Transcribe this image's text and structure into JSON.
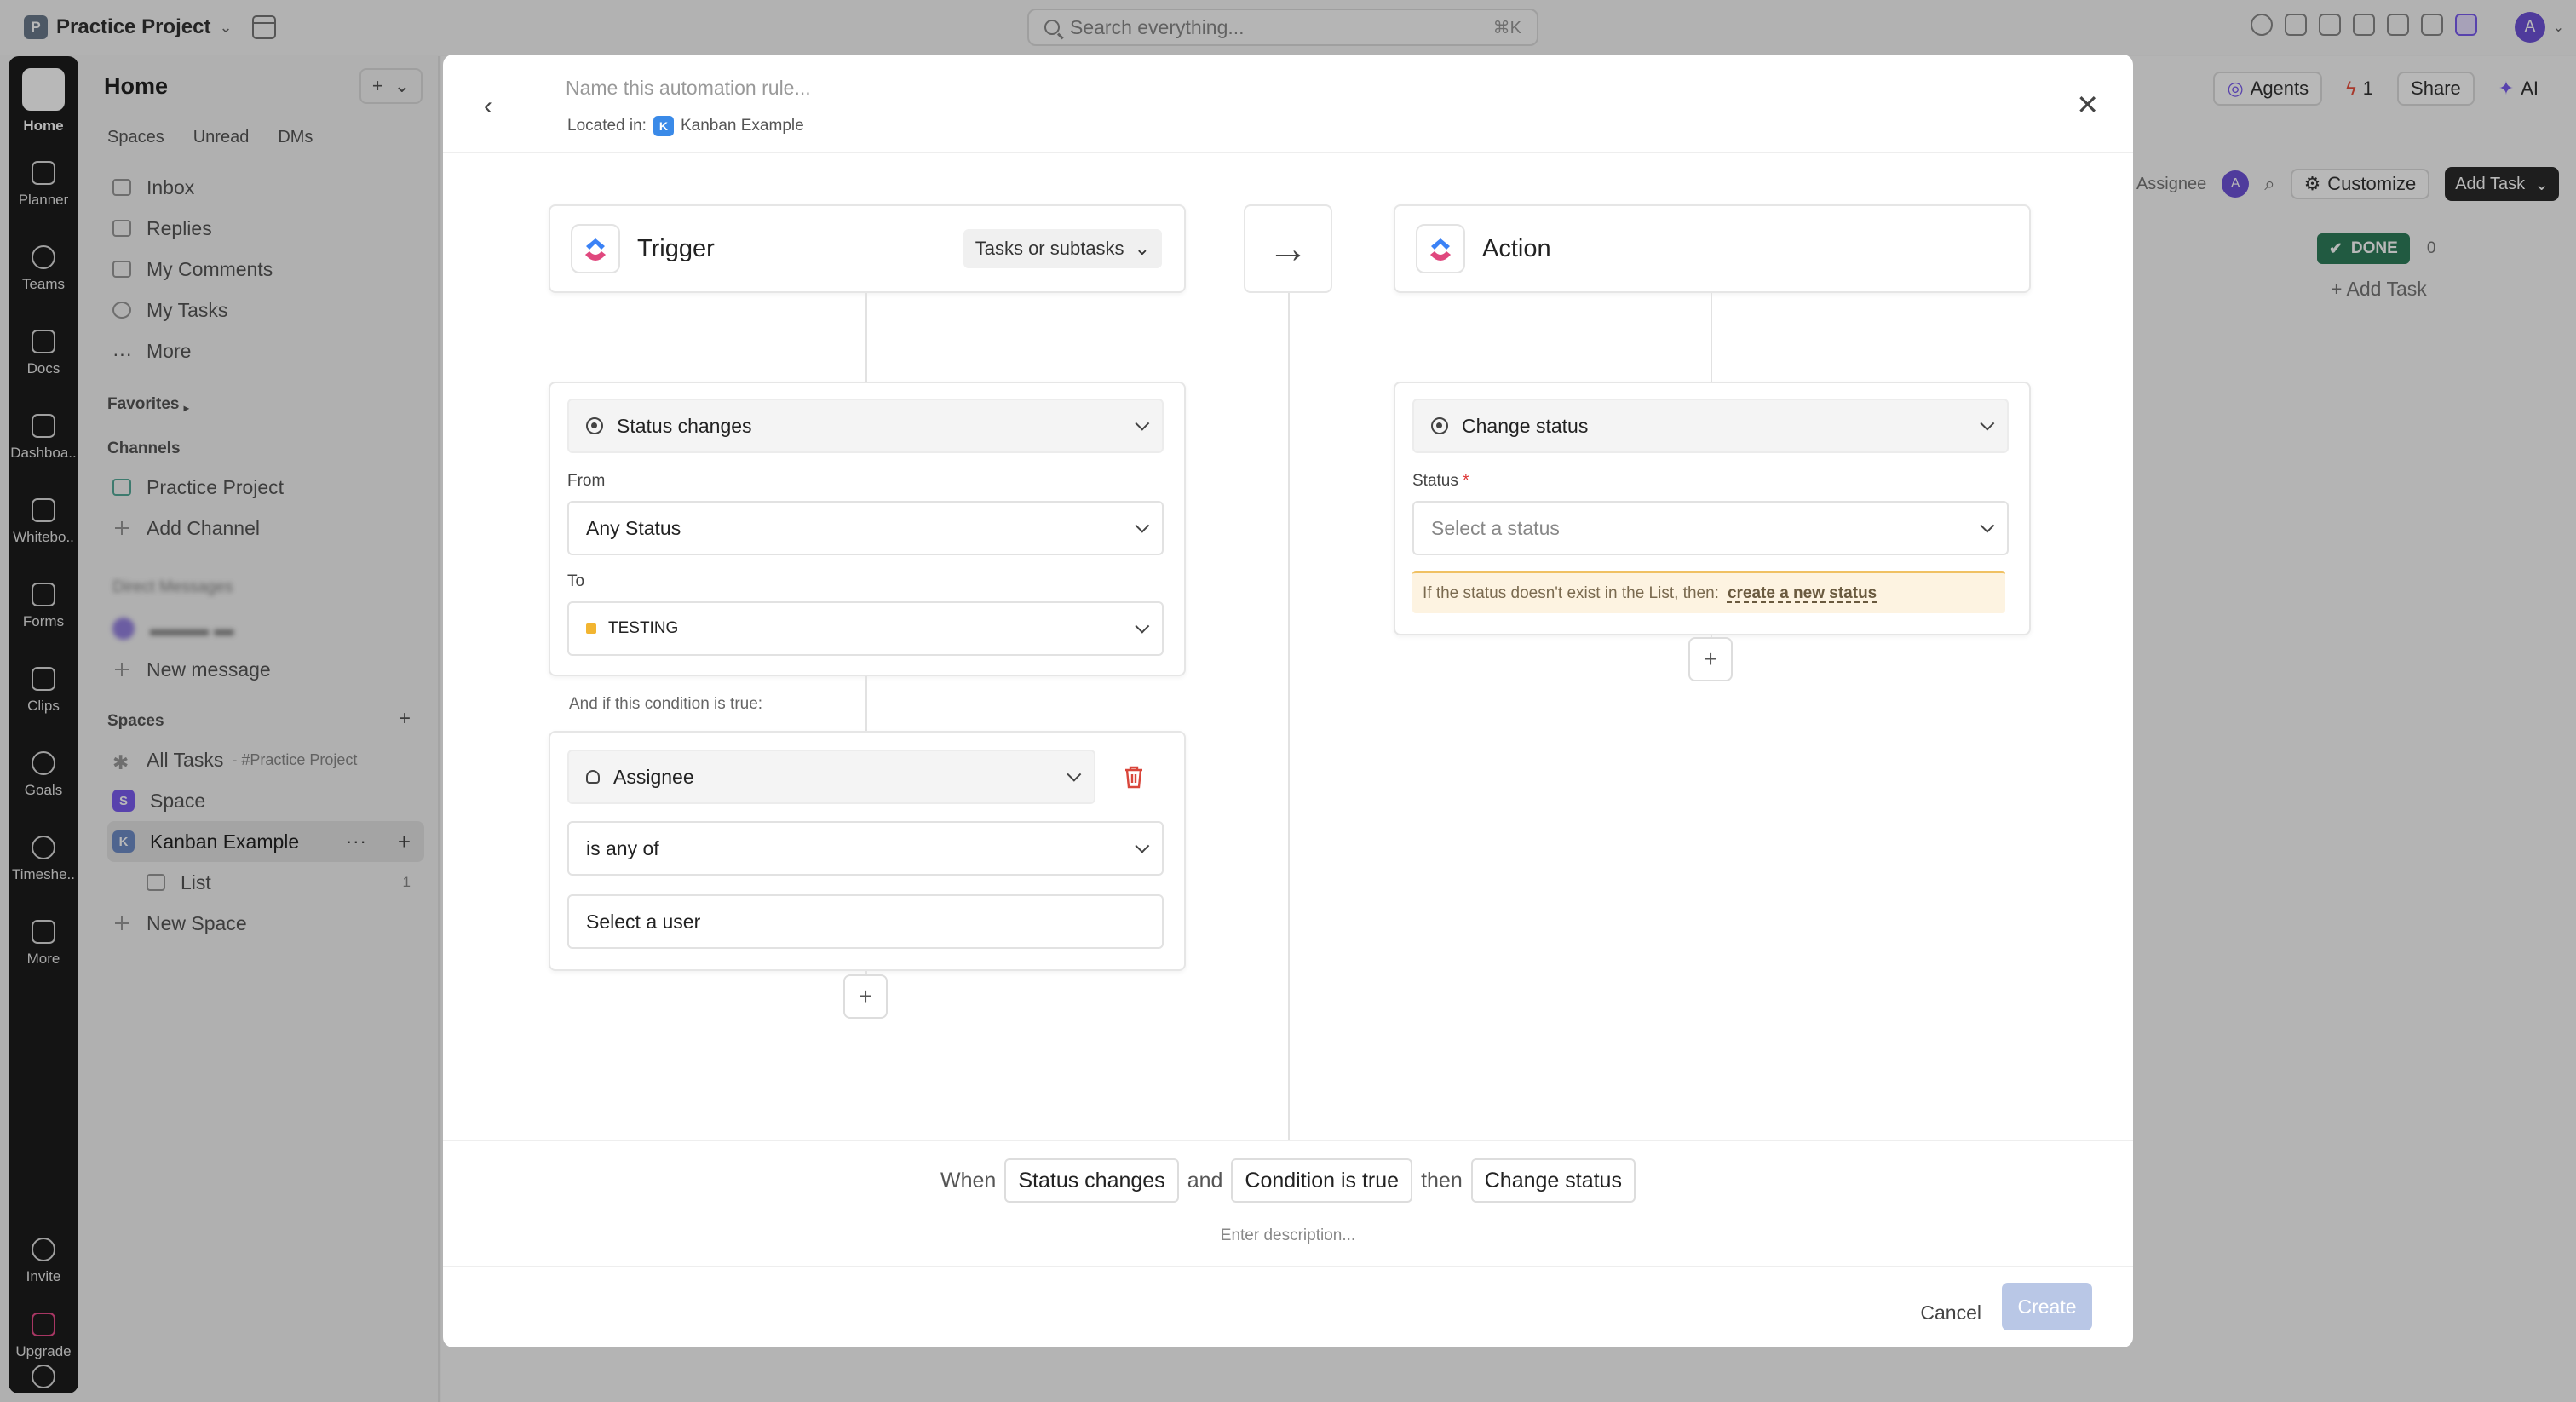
{
  "topbar": {
    "workspace_initial": "P",
    "workspace_name": "Practice Project",
    "search_placeholder": "Search everything...",
    "search_shortcut": "⌘K",
    "user_initial": "A"
  },
  "rail": {
    "items": [
      {
        "label": "Home",
        "icon": "home-icon"
      },
      {
        "label": "Planner",
        "icon": "calendar-icon"
      },
      {
        "label": "Teams",
        "icon": "teams-icon"
      },
      {
        "label": "Docs",
        "icon": "doc-icon"
      },
      {
        "label": "Dashboa..",
        "icon": "dashboard-icon"
      },
      {
        "label": "Whitebo..",
        "icon": "whiteboard-icon"
      },
      {
        "label": "Forms",
        "icon": "form-icon"
      },
      {
        "label": "Clips",
        "icon": "clip-icon"
      },
      {
        "label": "Goals",
        "icon": "trophy-icon"
      },
      {
        "label": "Timeshe..",
        "icon": "clock-icon"
      },
      {
        "label": "More",
        "icon": "grid-icon"
      },
      {
        "label": "Invite",
        "icon": "invite-icon"
      },
      {
        "label": "Upgrade",
        "icon": "upgrade-icon"
      }
    ]
  },
  "sidebar": {
    "title": "Home",
    "add_label": "+",
    "tabs": [
      "Spaces",
      "Unread",
      "DMs"
    ],
    "nav": [
      "Inbox",
      "Replies",
      "My Comments",
      "My Tasks",
      "More"
    ],
    "favorites_label": "Favorites",
    "channels_label": "Channels",
    "channels": [
      "Practice Project",
      "Add Channel"
    ],
    "dm_label": "Direct Messages",
    "new_message": "New message",
    "spaces_label": "Spaces",
    "all_tasks": "All Tasks",
    "all_tasks_sub": "- #Practice Project",
    "space_initial": "S",
    "space_name": "Space",
    "kanban_initial": "K",
    "kanban_name": "Kanban Example",
    "list_name": "List",
    "list_count": "1",
    "new_space": "New Space"
  },
  "background": {
    "agents": "Agents",
    "notif_count": "1",
    "share": "Share",
    "ai": "AI",
    "assignee": "Assignee",
    "assignee_initial": "A",
    "customize": "Customize",
    "add_task_btn": "Add Task",
    "done_label": "DONE",
    "done_count": "0",
    "add_task_link": "+ Add Task"
  },
  "modal": {
    "name_placeholder": "Name this automation rule...",
    "located_in": "Located in:",
    "location_initial": "K",
    "location_name": "Kanban Example",
    "trigger": {
      "title": "Trigger",
      "scope": "Tasks or subtasks",
      "event": "Status changes",
      "from_label": "From",
      "from_value": "Any Status",
      "to_label": "To",
      "to_value": "TESTING"
    },
    "condition": {
      "label": "And if this condition is true:",
      "field": "Assignee",
      "operator": "is any of",
      "value_placeholder": "Select a user"
    },
    "action": {
      "title": "Action",
      "event": "Change status",
      "status_label": "Status",
      "required_mark": "*",
      "status_placeholder": "Select a status",
      "warning": "If the status doesn't exist in the List, then:",
      "warning_link": "create a new status"
    },
    "summary": {
      "when": "When",
      "trigger_chip": "Status changes",
      "and": "and",
      "condition_chip": "Condition is true",
      "then": "then",
      "action_chip": "Change status",
      "desc_placeholder": "Enter description..."
    },
    "cancel": "Cancel",
    "create": "Create"
  },
  "colors": {
    "accent": "#7b68ee",
    "done_green": "#2e7d5b",
    "testing_yellow": "#f2b531",
    "delete_red": "#d9463b"
  }
}
